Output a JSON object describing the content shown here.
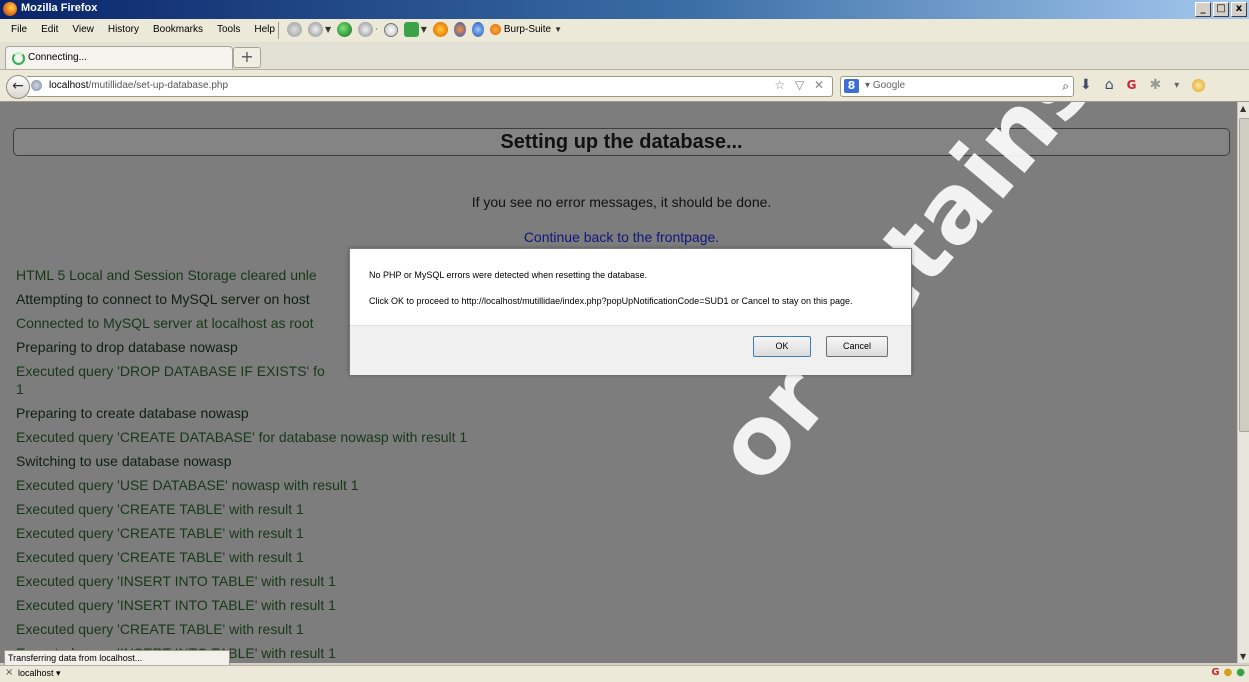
{
  "window": {
    "title": "Mozilla Firefox",
    "min": "_",
    "restore": "□",
    "close": "x"
  },
  "menu": [
    "File",
    "Edit",
    "View",
    "History",
    "Bookmarks",
    "Tools",
    "Help"
  ],
  "toolbar": {
    "burp_label": "Burp-Suite"
  },
  "tab": {
    "label": "Connecting...",
    "new_tab": "+"
  },
  "nav": {
    "back": "←",
    "url_host": "localhost",
    "url_path": "/mutillidae/set-up-database.php",
    "url_controls": "☆ ▽ ✕",
    "search_engine": "8",
    "search_placeholder": "Google",
    "search_icon": "⌕"
  },
  "page": {
    "heading": "Setting up the database...",
    "subline": "If you see no error messages, it should be done.",
    "continue_link": "Continue back to the frontpage.",
    "log": [
      "HTML 5 Local and Session Storage cleared unle",
      "Attempting to connect to MySQL server on host",
      "Connected to MySQL server at localhost as root",
      "Preparing to drop database nowasp",
      "Executed query 'DROP DATABASE IF EXISTS' fo",
      "1",
      "Preparing to create database nowasp",
      "Executed query 'CREATE DATABASE' for database nowasp with result 1",
      "Switching to use database nowasp",
      "Executed query 'USE DATABASE' nowasp with result 1",
      "Executed query 'CREATE TABLE' with result 1",
      "Executed query 'CREATE TABLE' with result 1",
      "Executed query 'CREATE TABLE' with result 1",
      "Executed query 'INSERT INTO TABLE' with result 1",
      "Executed query 'INSERT INTO TABLE' with result 1",
      "Executed query 'CREATE TABLE' with result 1",
      "Executed query 'INSERT INTO TABLE' with result 1"
    ],
    "watermark": "or retains full rights"
  },
  "dialog": {
    "message_1": "No PHP or MySQL errors were detected when resetting the database.",
    "message_2": "Click OK to proceed to http://localhost/mutillidae/index.php?popUpNotificationCode=SUD1 or Cancel to stay on this page.",
    "ok": "OK",
    "cancel": "Cancel"
  },
  "status": {
    "text": "Transferring data from localhost...",
    "host": "localhost",
    "close": "×"
  }
}
